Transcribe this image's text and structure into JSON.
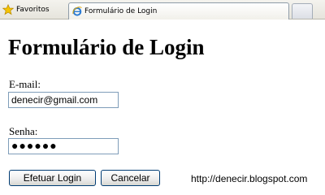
{
  "toolbar": {
    "favorites_label": "Favoritos",
    "tab_title": "Formulário de Login"
  },
  "page": {
    "title": "Formulário de Login",
    "email_label": "E-mail:",
    "email_value": "denecir@gmail.com",
    "password_label": "Senha:",
    "password_masked": "●●●●●●",
    "login_button": "Efetuar Login",
    "cancel_button": "Cancelar"
  },
  "watermark": "http://denecir.blogspot.com",
  "icons": {
    "favorites": "star-icon",
    "tab": "internet-explorer-icon"
  },
  "colors": {
    "input_border": "#7f9db9",
    "button_border": "#003c74",
    "star": "#f5c400"
  }
}
